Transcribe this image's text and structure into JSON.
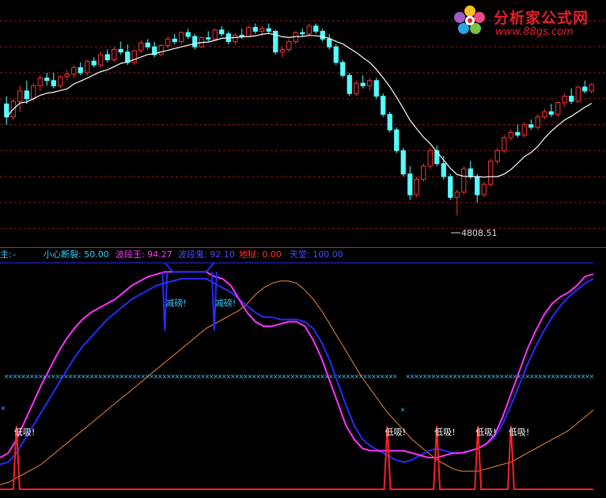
{
  "watermark": {
    "site_name": "分析家公式网",
    "url": "www.88gs.com"
  },
  "legend": {
    "main_label": "主:",
    "main_value": "-",
    "items": [
      {
        "label": "小心断裂",
        "value": "50.00",
        "color": "#33ccff"
      },
      {
        "label": "波段王",
        "value": "94.27",
        "color": "#ff33ff"
      },
      {
        "label": "波段鬼",
        "value": "92.10",
        "color": "#3333ff"
      },
      {
        "label": "地狱",
        "value": "0.00",
        "color": "#ff3333"
      },
      {
        "label": "天堂",
        "value": "100.00",
        "color": "#3333ff"
      }
    ]
  },
  "colors": {
    "up_candle": "#ff3232",
    "down_candle": "#54ffff",
    "ma_line": "#ffffff",
    "grid": "#8b1a1a",
    "panel_border": "#c0282d",
    "wave_king": "#ff33ff",
    "wave_ghost": "#2a2aff",
    "slow_line": "#f0883a",
    "signal": "#ff2222",
    "level_dots": "#33ccff",
    "annotation": "#ffffff"
  },
  "chart_data": [
    {
      "type": "candlestick",
      "title": "",
      "low_annotation": "4808.51",
      "ylim": [
        4700,
        5600
      ],
      "candles": [
        [
          5230,
          5260,
          5150,
          5180
        ],
        [
          5180,
          5250,
          5170,
          5240
        ],
        [
          5240,
          5300,
          5200,
          5280
        ],
        [
          5280,
          5320,
          5230,
          5250
        ],
        [
          5250,
          5310,
          5240,
          5300
        ],
        [
          5300,
          5340,
          5280,
          5330
        ],
        [
          5330,
          5350,
          5300,
          5320
        ],
        [
          5320,
          5350,
          5290,
          5300
        ],
        [
          5300,
          5340,
          5290,
          5335
        ],
        [
          5335,
          5360,
          5320,
          5345
        ],
        [
          5345,
          5380,
          5330,
          5370
        ],
        [
          5370,
          5390,
          5340,
          5350
        ],
        [
          5350,
          5400,
          5340,
          5395
        ],
        [
          5395,
          5410,
          5370,
          5380
        ],
        [
          5380,
          5430,
          5370,
          5420
        ],
        [
          5420,
          5440,
          5390,
          5400
        ],
        [
          5400,
          5450,
          5390,
          5440
        ],
        [
          5440,
          5470,
          5420,
          5430
        ],
        [
          5430,
          5460,
          5380,
          5390
        ],
        [
          5390,
          5440,
          5380,
          5435
        ],
        [
          5435,
          5475,
          5425,
          5465
        ],
        [
          5465,
          5480,
          5440,
          5450
        ],
        [
          5450,
          5470,
          5410,
          5420
        ],
        [
          5420,
          5460,
          5415,
          5455
        ],
        [
          5455,
          5490,
          5445,
          5480
        ],
        [
          5480,
          5500,
          5460,
          5470
        ],
        [
          5470,
          5510,
          5460,
          5505
        ],
        [
          5505,
          5520,
          5480,
          5490
        ],
        [
          5490,
          5500,
          5440,
          5450
        ],
        [
          5450,
          5490,
          5445,
          5485
        ],
        [
          5485,
          5510,
          5470,
          5480
        ],
        [
          5480,
          5520,
          5475,
          5515
        ],
        [
          5515,
          5530,
          5490,
          5500
        ],
        [
          5500,
          5510,
          5460,
          5470
        ],
        [
          5470,
          5500,
          5460,
          5495
        ],
        [
          5495,
          5520,
          5480,
          5490
        ],
        [
          5490,
          5530,
          5485,
          5525
        ],
        [
          5525,
          5540,
          5500,
          5510
        ],
        [
          5510,
          5530,
          5490,
          5520
        ],
        [
          5520,
          5540,
          5500,
          5510
        ],
        [
          5510,
          5515,
          5420,
          5430
        ],
        [
          5430,
          5450,
          5410,
          5440
        ],
        [
          5440,
          5480,
          5430,
          5470
        ],
        [
          5470,
          5510,
          5460,
          5505
        ],
        [
          5505,
          5520,
          5490,
          5500
        ],
        [
          5500,
          5540,
          5490,
          5530
        ],
        [
          5530,
          5540,
          5500,
          5510
        ],
        [
          5510,
          5520,
          5470,
          5480
        ],
        [
          5480,
          5500,
          5440,
          5450
        ],
        [
          5450,
          5460,
          5380,
          5390
        ],
        [
          5390,
          5400,
          5330,
          5340
        ],
        [
          5340,
          5350,
          5260,
          5270
        ],
        [
          5270,
          5320,
          5260,
          5310
        ],
        [
          5310,
          5340,
          5290,
          5300
        ],
        [
          5300,
          5330,
          5280,
          5320
        ],
        [
          5320,
          5330,
          5250,
          5260
        ],
        [
          5260,
          5270,
          5180,
          5190
        ],
        [
          5190,
          5200,
          5120,
          5130
        ],
        [
          5130,
          5140,
          5040,
          5050
        ],
        [
          5050,
          5060,
          4950,
          4960
        ],
        [
          4960,
          4990,
          4860,
          4880
        ],
        [
          4880,
          4950,
          4870,
          4940
        ],
        [
          4940,
          5000,
          4930,
          4990
        ],
        [
          4990,
          5060,
          4980,
          5050
        ],
        [
          5050,
          5070,
          4990,
          5000
        ],
        [
          5000,
          5030,
          4940,
          4950
        ],
        [
          4950,
          4960,
          4860,
          4870
        ],
        [
          4870,
          4900,
          4800,
          4890
        ],
        [
          4890,
          4990,
          4880,
          4980
        ],
        [
          4980,
          5010,
          4940,
          4950
        ],
        [
          4950,
          4960,
          4850,
          4880
        ],
        [
          4880,
          4930,
          4870,
          4920
        ],
        [
          4920,
          5020,
          4910,
          5010
        ],
        [
          5010,
          5060,
          5000,
          5050
        ],
        [
          5050,
          5110,
          5040,
          5100
        ],
        [
          5100,
          5130,
          5090,
          5120
        ],
        [
          5120,
          5150,
          5100,
          5110
        ],
        [
          5110,
          5160,
          5100,
          5150
        ],
        [
          5150,
          5170,
          5130,
          5140
        ],
        [
          5140,
          5190,
          5130,
          5180
        ],
        [
          5180,
          5210,
          5170,
          5200
        ],
        [
          5200,
          5230,
          5180,
          5190
        ],
        [
          5190,
          5240,
          5180,
          5235
        ],
        [
          5235,
          5270,
          5220,
          5260
        ],
        [
          5260,
          5290,
          5230,
          5240
        ],
        [
          5240,
          5300,
          5235,
          5295
        ],
        [
          5295,
          5320,
          5270,
          5280
        ],
        [
          5280,
          5310,
          5270,
          5305
        ]
      ],
      "ma_period": 10
    },
    {
      "type": "line",
      "title": "",
      "ylim": [
        0,
        100
      ],
      "level_line": 50,
      "top_line": 100,
      "series": [
        {
          "name": "波段王",
          "key": "wave_king",
          "values": [
            14,
            16,
            22,
            30,
            38,
            46,
            53,
            60,
            66,
            71,
            75,
            78,
            80,
            82,
            84,
            87,
            90,
            92,
            94,
            95,
            96,
            96,
            96,
            96,
            96,
            96,
            94,
            93,
            90,
            84,
            78,
            74,
            72,
            72,
            73,
            74,
            74,
            72,
            66,
            58,
            48,
            38,
            28,
            22,
            18,
            17,
            17,
            17,
            17,
            17,
            16,
            15,
            14,
            14,
            15,
            16,
            16,
            17,
            18,
            20,
            24,
            32,
            42,
            52,
            62,
            70,
            77,
            82,
            85,
            87,
            90,
            94,
            95
          ]
        },
        {
          "name": "波段鬼",
          "key": "wave_ghost",
          "values": [
            11,
            12,
            16,
            22,
            28,
            34,
            40,
            46,
            52,
            58,
            63,
            67,
            71,
            75,
            78,
            81,
            84,
            86,
            88,
            90,
            91,
            92,
            93,
            93,
            93,
            93,
            91,
            89,
            87,
            84,
            81,
            78,
            76,
            76,
            75,
            75,
            75,
            74,
            71,
            65,
            57,
            47,
            37,
            28,
            22,
            19,
            17,
            15,
            13,
            12,
            13,
            15,
            17,
            18,
            17,
            16,
            16,
            17,
            18,
            20,
            23,
            29,
            37,
            46,
            55,
            63,
            70,
            76,
            81,
            85,
            88,
            91,
            93
          ]
        },
        {
          "name": "",
          "key": "slow_line",
          "values": [
            2,
            3,
            5,
            7,
            9,
            11,
            14,
            17,
            20,
            23,
            26,
            29,
            32,
            35,
            38,
            41,
            44,
            47,
            50,
            53,
            56,
            59,
            62,
            65,
            68,
            71,
            73,
            75,
            77,
            79,
            82,
            86,
            89,
            91,
            92,
            92,
            91,
            88,
            84,
            79,
            73,
            67,
            61,
            55,
            49,
            44,
            39,
            34,
            30,
            26,
            22,
            19,
            16,
            13,
            11,
            9,
            8,
            8,
            8,
            9,
            10,
            11,
            12,
            14,
            16,
            18,
            20,
            22,
            24,
            26,
            29,
            32,
            35
          ]
        }
      ],
      "annotations": {
        "sell_label": "减磅!",
        "buy_label": "低吸!"
      }
    }
  ]
}
